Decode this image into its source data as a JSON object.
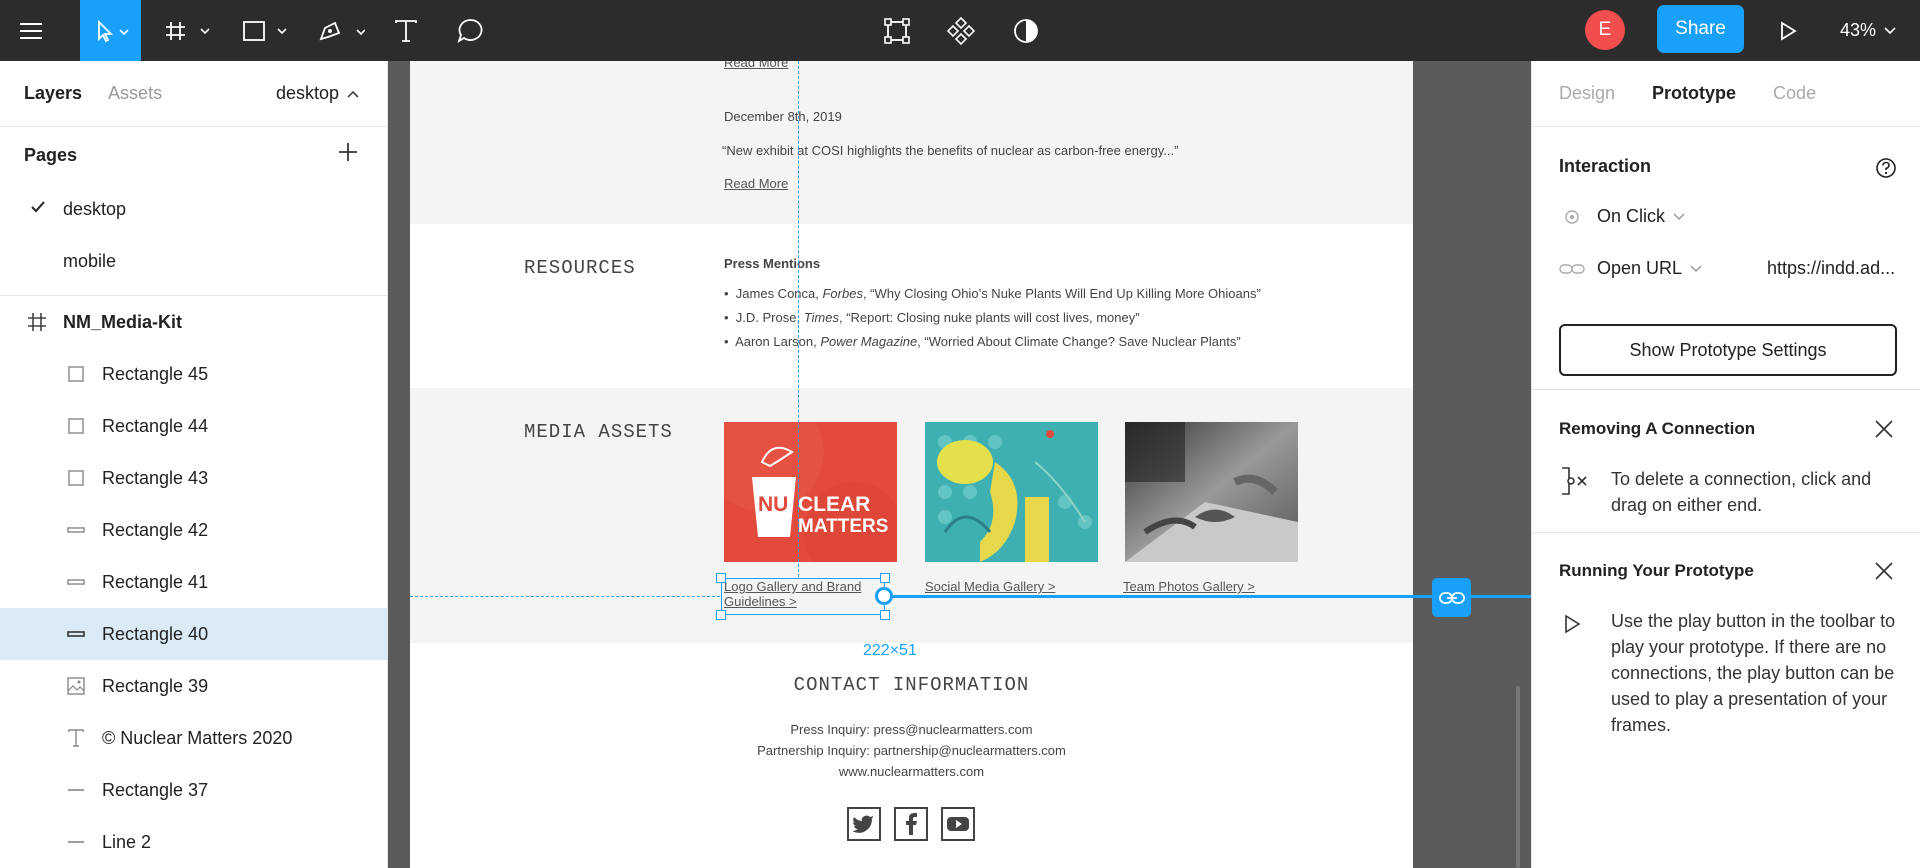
{
  "toolbar": {
    "zoom": "43%",
    "share_label": "Share",
    "avatar_initial": "E",
    "accent": "#18a0fb"
  },
  "left_panel": {
    "tab_layers": "Layers",
    "tab_assets": "Assets",
    "current_page": "desktop",
    "pages_heading": "Pages",
    "pages": [
      "desktop",
      "mobile"
    ],
    "frame_name": "NM_Media-Kit",
    "layers": [
      {
        "name": "Rectangle 45",
        "icon": "rectangle-icon"
      },
      {
        "name": "Rectangle 44",
        "icon": "rectangle-icon"
      },
      {
        "name": "Rectangle 43",
        "icon": "rectangle-icon"
      },
      {
        "name": "Rectangle 42",
        "icon": "thin-rectangle-icon"
      },
      {
        "name": "Rectangle 41",
        "icon": "thin-rectangle-icon"
      },
      {
        "name": "Rectangle 40",
        "icon": "thin-rectangle-icon"
      },
      {
        "name": "Rectangle 39",
        "icon": "image-icon"
      },
      {
        "name": "© Nuclear Matters 2020",
        "icon": "text-icon"
      },
      {
        "name": "Rectangle 37",
        "icon": "line-icon"
      },
      {
        "name": "Line 2",
        "icon": "line-icon"
      }
    ]
  },
  "canvas": {
    "read_more_1": "Read More",
    "news_date": "December 8th, 2019",
    "news_quote": "“New exhibit at COSI highlights the benefits of nuclear as carbon-free energy...”",
    "read_more_2": "Read More",
    "resources_heading": "RESOURCES",
    "press_heading": "Press Mentions",
    "press": [
      {
        "author": "James Conca, ",
        "outlet": "Forbes",
        "title": ", “Why Closing Ohio’s Nuke Plants Will End Up Killing More Ohioans”"
      },
      {
        "author": "J.D. Prose, ",
        "outlet": "Times",
        "title": ", “Report: Closing nuke plants will cost lives, money”"
      },
      {
        "author": "Aaron Larson, ",
        "outlet": "Power Magazine",
        "title": ", “Worried About Climate Change? Save Nuclear Plants”"
      }
    ],
    "media_heading": "MEDIA ASSETS",
    "logo_nu": "NU",
    "logo_clear": "CLEAR",
    "logo_matters": "MATTERS",
    "gallery_1": "Logo Gallery and Brand Guidelines >",
    "gallery_2": "Social Media Gallery >",
    "gallery_3": "Team Photos Gallery >",
    "selection_size": "222×51",
    "contact_heading": "CONTACT INFORMATION",
    "press_inquiry": "Press Inquiry: press@nuclearmatters.com",
    "partnership_inquiry": "Partnership Inquiry: partnership@nuclearmatters.com",
    "website": "www.nuclearmatters.com",
    "social_icons": [
      "twitter-icon",
      "facebook-icon",
      "youtube-icon"
    ]
  },
  "right_panel": {
    "tab_design": "Design",
    "tab_prototype": "Prototype",
    "tab_code": "Code",
    "interaction_heading": "Interaction",
    "trigger": "On Click",
    "action": "Open URL",
    "url": "https://indd.ad...",
    "settings_button": "Show Prototype Settings",
    "tip1_title": "Removing A Connection",
    "tip1_text": "To delete a connection, click and drag on either end.",
    "tip2_title": "Running Your Prototype",
    "tip2_text": "Use the play button in the toolbar to play your prototype. If there are no connections, the play button can be used to play a presentation of your frames."
  }
}
